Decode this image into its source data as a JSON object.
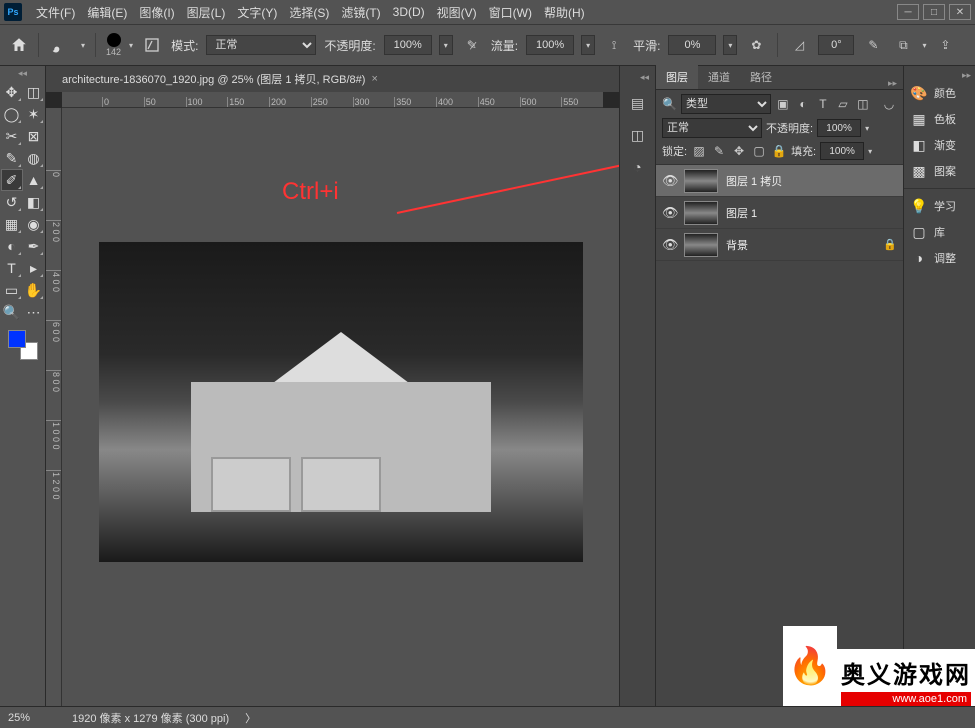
{
  "menu": {
    "file": "文件(F)",
    "edit": "编辑(E)",
    "image": "图像(I)",
    "layer": "图层(L)",
    "type": "文字(Y)",
    "select": "选择(S)",
    "filter": "滤镜(T)",
    "threed": "3D(D)",
    "view": "视图(V)",
    "window": "窗口(W)",
    "help": "帮助(H)"
  },
  "options": {
    "brush_size": "142",
    "mode_label": "模式:",
    "mode_value": "正常",
    "opacity_label": "不透明度:",
    "opacity_value": "100%",
    "flow_label": "流量:",
    "flow_value": "100%",
    "smooth_label": "平滑:",
    "smooth_value": "0%",
    "angle_value": "0°"
  },
  "doc": {
    "tab_title": "architecture-1836070_1920.jpg @ 25% (图层 1 拷贝, RGB/8#)",
    "annotation": "Ctrl+i"
  },
  "ruler_h": [
    "0",
    "50",
    "100",
    "150",
    "200",
    "250",
    "300",
    "350",
    "400",
    "450",
    "500",
    "550"
  ],
  "ruler_v": [
    "0",
    "2 0 0",
    "4 0 0",
    "6 0 0",
    "8 0 0",
    "1 0 0 0",
    "1 2 0 0"
  ],
  "panels": {
    "tab_layers": "图层",
    "tab_channels": "通道",
    "tab_paths": "路径",
    "filter_label": "类型",
    "blend_value": "正常",
    "opacity_label": "不透明度:",
    "opacity_value": "100%",
    "lock_label": "锁定:",
    "fill_label": "填充:",
    "fill_value": "100%",
    "layers": [
      {
        "name": "图层 1 拷贝"
      },
      {
        "name": "图层 1"
      },
      {
        "name": "背景"
      }
    ]
  },
  "side": {
    "color": "颜色",
    "swatches": "色板",
    "gradient": "渐变",
    "patterns": "图案",
    "learn": "学习",
    "library": "库",
    "adjust": "调整"
  },
  "status": {
    "zoom": "25%",
    "info": "1920 像素 x 1279 像素 (300 ppi)",
    "arrow": "〉"
  },
  "watermark": {
    "text": "奥义游戏网",
    "url": "www.aoe1.com"
  }
}
